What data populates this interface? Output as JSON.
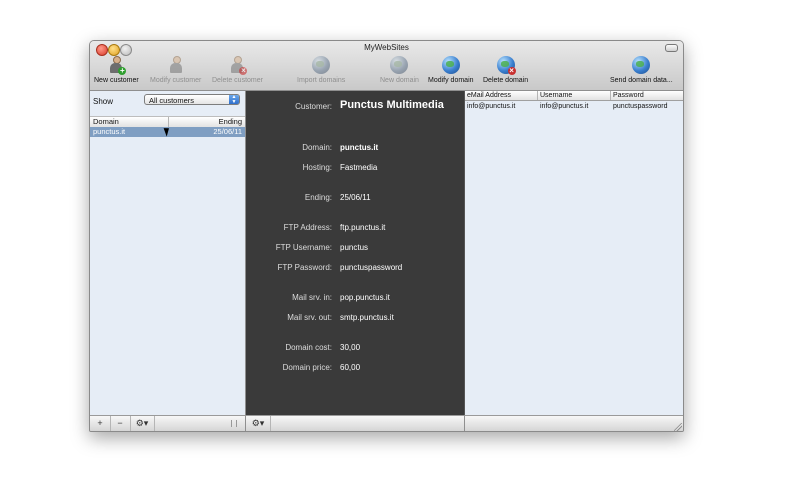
{
  "window": {
    "title": "MyWebSites"
  },
  "toolbar": {
    "new_customer": "New  customer",
    "modify_customer": "Modify customer",
    "delete_customer": "Delete customer",
    "import_domains": "Import domains",
    "new_domain": "New domain",
    "modify_domain": "Modify domain",
    "delete_domain": "Delete domain",
    "send_domain_data": "Send domain data..."
  },
  "left": {
    "show_label": "Show",
    "filter_value": "All customers",
    "columns": {
      "domain": "Domain",
      "ending": "Ending"
    },
    "rows": [
      {
        "domain": "punctus.it",
        "ending": "25/06/11"
      }
    ],
    "add": "+",
    "remove": "−"
  },
  "detail": {
    "customer_label": "Customer:",
    "customer_value": "Punctus Multimedia",
    "domain_label": "Domain:",
    "domain_value": "punctus.it",
    "hosting_label": "Hosting:",
    "hosting_value": "Fastmedia",
    "ending_label": "Ending:",
    "ending_value": "25/06/11",
    "ftp_address_label": "FTP Address:",
    "ftp_address_value": "ftp.punctus.it",
    "ftp_username_label": "FTP Username:",
    "ftp_username_value": "punctus",
    "ftp_password_label": "FTP Password:",
    "ftp_password_value": "punctuspassword",
    "mail_in_label": "Mail srv. in:",
    "mail_in_value": "pop.punctus.it",
    "mail_out_label": "Mail srv. out:",
    "mail_out_value": "smtp.punctus.it",
    "cost_label": "Domain cost:",
    "cost_value": "30,00",
    "price_label": "Domain price:",
    "price_value": "60,00"
  },
  "email_table": {
    "columns": {
      "email": "eMail Address",
      "username": "Username",
      "password": "Password"
    },
    "rows": [
      {
        "email": "info@punctus.it",
        "username": "info@punctus.it",
        "password": "punctuspassword"
      }
    ]
  }
}
